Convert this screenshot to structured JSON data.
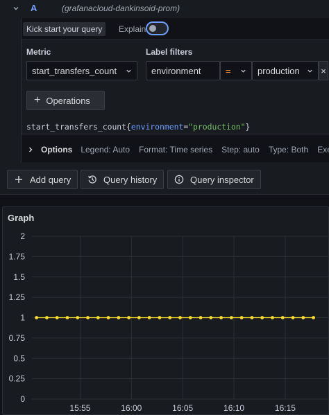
{
  "query": {
    "letter": "A",
    "datasource": "(grafanacloud-dankinsoid-prom)",
    "kick_start_label": "Kick start your query",
    "explain_label": "Explain",
    "explain_enabled": false,
    "metric_label": "Metric",
    "metric_value": "start_transfers_count",
    "label_filters_label": "Label filters",
    "filter_label": "environment",
    "filter_operator": "=",
    "filter_value": "production",
    "remove_filter_glyph": "×",
    "operations_label": "Operations",
    "promql": {
      "metric": "start_transfers_count",
      "open_brace": "{",
      "label": "environment",
      "eq": "=",
      "value": "\"production\"",
      "close_brace": "}"
    },
    "options": {
      "title": "Options",
      "legend": "Legend: Auto",
      "format": "Format: Time series",
      "step": "Step: auto",
      "type": "Type: Both",
      "exemplars": "Exempl"
    }
  },
  "actions": {
    "add_query": "Add query",
    "query_history": "Query history",
    "query_inspector": "Query inspector"
  },
  "graph": {
    "title": "Graph"
  },
  "colors": {
    "accent": "#6e9fff",
    "operator": "#ff9830",
    "string": "#73bf69",
    "series": "#fade2a"
  },
  "chart_data": {
    "type": "line",
    "title": "Graph",
    "ylim": [
      0,
      2
    ],
    "yticks": [
      "2",
      "1.75",
      "1.5",
      "1.25",
      "1",
      "0.75",
      "0.5",
      "0.25",
      "0"
    ],
    "xticks": [
      "15:55",
      "16:00",
      "16:05",
      "16:10",
      "16:15"
    ],
    "xtick_minutes": [
      955,
      960,
      965,
      970,
      975
    ],
    "xlim_minutes": [
      950.3,
      979.2
    ],
    "grid": true,
    "series": [
      {
        "color": "#fade2a",
        "x_minutes": [
          950.75,
          951.75,
          952.75,
          953.75,
          954.75,
          955.75,
          956.75,
          957.75,
          958.75,
          959.75,
          960.75,
          961.75,
          962.75,
          963.75,
          964.75,
          965.75,
          966.75,
          967.75,
          968.75,
          969.75,
          970.75,
          971.75,
          972.75,
          973.75,
          974.75,
          975.75,
          976.75,
          977.75
        ],
        "values": [
          1,
          1,
          1,
          1,
          1,
          1,
          1,
          1,
          1,
          1,
          1,
          1,
          1,
          1,
          1,
          1,
          1,
          1,
          1,
          1,
          1,
          1,
          1,
          1,
          1,
          1,
          1,
          1
        ]
      }
    ]
  }
}
